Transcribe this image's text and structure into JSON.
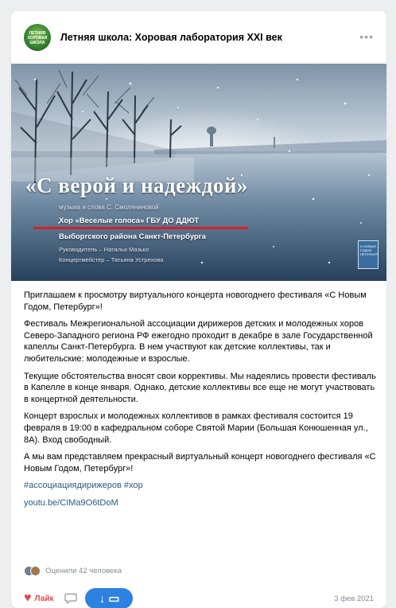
{
  "post": {
    "group_name": "Летняя школа: Хоровая лаборатория XXI век",
    "avatar_text": "ЛЕТНЯЯ ХОРОВАЯ ШКОЛА",
    "more_icon": "more-dots-icon",
    "media": {
      "title": "«С верой и надеждой»",
      "subtitle": "музыка и слова С. Смоляниновой",
      "choir_line1": "Хор «Веселые голоса» ГБУ ДО ДДЮТ",
      "choir_line2": "Выборгского района Санкт-Петербурга",
      "leader": "Руководитель – Наталья Мазько",
      "accompanist": "Концертмейстер – Татьяна Устрехова",
      "badge_text": "С НОВЫМ ГОДОМ ПЕТЕРБУРГ"
    },
    "paragraphs": [
      "Приглашаем к просмотру виртуального концерта новогоднего фестиваля «С Новым Годом, Петербург»!",
      "Фестиваль Межрегиональной ассоциации дирижеров детских и молодежных хоров Северо-Западного региона РФ ежегодно проходит в декабре в зале Государственной капеллы Санкт-Петербурга. В нем участвуют как детские коллективы, так и любительские: молодежные и взрослые.",
      "Текущие обстоятельства вносят свои коррективы. Мы надеялись провести фестиваль в Капелле в конце января. Однако, детские коллективы все еще не могут участвовать в концертной деятельности.",
      "Концерт взрослых и молодежных коллективов в рамках фестиваля состоится 19 февраля в 19:00 в кафедральном соборе Святой Марии (Большая Конюшенная ул., 8А). Вход свободный.",
      "А мы вам представляем прекрасный виртуальный концерт новогоднего фестиваля «С Новым Годом, Петербург»!"
    ],
    "hashtags": "#ассоциациядирижеров #хор",
    "video_link": "youtu.be/CIMa9O6tDoM",
    "likes_text": "Оценили 42 человека",
    "like_label": "Лайк",
    "share_symbol": "↓ ▭",
    "date": "3 фев 2021",
    "colors": {
      "accent": "#2d81e0",
      "like": "#e64646",
      "link": "#2a5885",
      "muted": "#818c99"
    }
  }
}
